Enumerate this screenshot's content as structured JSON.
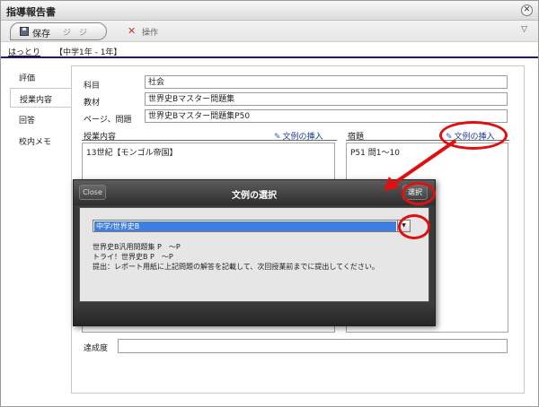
{
  "window": {
    "title": "指導報告書"
  },
  "toolbar": {
    "save_label": "保存",
    "undo_label": "ジ",
    "redo_label": "ジ",
    "tools_label": "操作"
  },
  "header": {
    "left_text": "はっとり",
    "class_text": "【中学1年 - 1年】"
  },
  "sidebar": {
    "items": [
      {
        "label": "評価"
      },
      {
        "label": "授業内容"
      },
      {
        "label": "回答"
      },
      {
        "label": "校内メモ"
      }
    ]
  },
  "form": {
    "subject_label": "科目",
    "subject_value": "社会",
    "material_label": "教材",
    "material_value": "世界史Bマスター問題集",
    "page_label": "ページ、問題",
    "page_value": "世界史Bマスター問題集P50",
    "lesson_label": "授業内容",
    "lesson_insert_label": "文例の挿入",
    "lesson_text": "13世紀【モンゴル帝国】",
    "homework_label": "宿題",
    "homework_insert_label": "文例の挿入",
    "homework_text": "P51 問1～10",
    "achievement_label": "達成度"
  },
  "dialog": {
    "close_label": "Close",
    "title": "文例の選択",
    "select_label": "選択",
    "combo_value": "中学/世界史B",
    "lines": [
      "世界史B汎用問題集 P　～P",
      "トライ！世界史B P　～P",
      "提出：レポート用紙に上記問題の解答を記載して、次回授業前までに提出してください。"
    ]
  },
  "colors": {
    "highlight_red": "#e01010",
    "select_blue": "#3d7ee0",
    "header_rule": "#1a1a7a"
  }
}
